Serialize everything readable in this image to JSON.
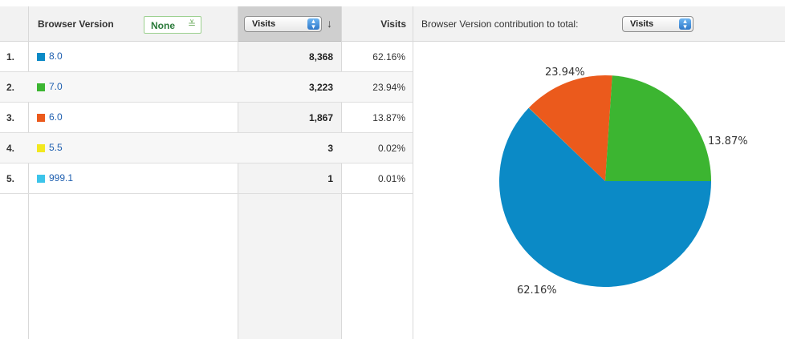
{
  "columns": {
    "dimension": "Browser Version",
    "secondary": "None",
    "sort_select": "Visits",
    "percent": "Visits",
    "contribution_label": "Browser Version contribution to total:",
    "contribution_select": "Visits"
  },
  "rows": [
    {
      "rank": "1.",
      "version": "8.0",
      "visits": "8,368",
      "percent": "62.16%",
      "color": "#0b8ac6"
    },
    {
      "rank": "2.",
      "version": "7.0",
      "visits": "3,223",
      "percent": "23.94%",
      "color": "#3cb531"
    },
    {
      "rank": "3.",
      "version": "6.0",
      "visits": "1,867",
      "percent": "13.87%",
      "color": "#eb5a1c"
    },
    {
      "rank": "4.",
      "version": "5.5",
      "visits": "3",
      "percent": "0.02%",
      "color": "#f2e81f"
    },
    {
      "rank": "5.",
      "version": "999.1",
      "visits": "1",
      "percent": "0.01%",
      "color": "#3cc4ea"
    }
  ],
  "chart_data": {
    "type": "pie",
    "slices": [
      {
        "label": "8.0",
        "value": 62.16,
        "text": "62.16%",
        "color": "#0b8ac6"
      },
      {
        "label": "7.0",
        "value": 23.94,
        "text": "23.94%",
        "color": "#3cb531"
      },
      {
        "label": "6.0",
        "value": 13.87,
        "text": "13.87%",
        "color": "#eb5a1c"
      },
      {
        "label": "5.5",
        "value": 0.02,
        "text": "",
        "color": "#f2e81f"
      },
      {
        "label": "999.1",
        "value": 0.01,
        "text": "",
        "color": "#3cc4ea"
      }
    ]
  }
}
